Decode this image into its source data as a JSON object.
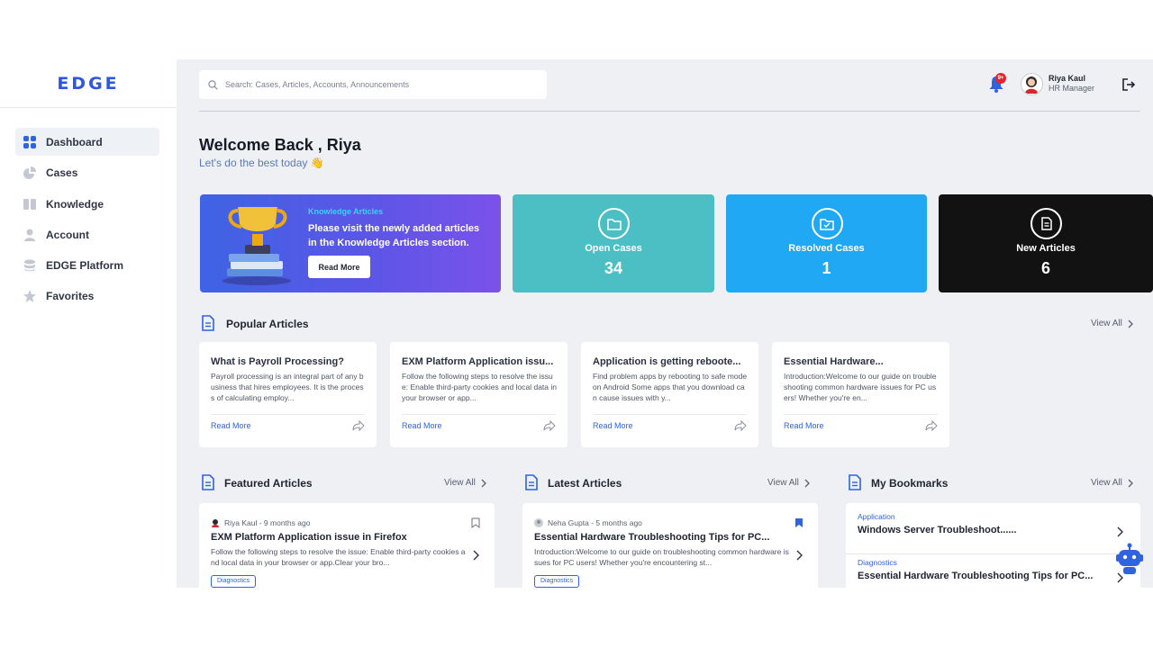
{
  "brand": {
    "logo": "EDGE",
    "accent": "#2c57e0"
  },
  "sidebar": {
    "items": [
      {
        "label": "Dashboard",
        "icon": "grid-icon",
        "active": true
      },
      {
        "label": "Cases",
        "icon": "pie-chart-icon"
      },
      {
        "label": "Knowledge",
        "icon": "book-icon"
      },
      {
        "label": "Account",
        "icon": "user-icon"
      },
      {
        "label": "EDGE Platform",
        "icon": "database-icon"
      },
      {
        "label": "Favorites",
        "icon": "star-icon"
      }
    ]
  },
  "header": {
    "search_placeholder": "Search: Cases, Articles, Accounts, Announcements",
    "notification_badge": "9+",
    "user": {
      "name": "Riya Kaul",
      "role": "HR Manager"
    }
  },
  "welcome": {
    "title": "Welcome Back , Riya",
    "subtitle": "Let's do the best today 👋"
  },
  "knowledge_banner": {
    "title": "Knowledge Articles",
    "text": "Please visit the newly added articles in the Knowledge Articles section.",
    "button": "Read More"
  },
  "stats": [
    {
      "label": "Open Cases",
      "value": "34",
      "color": "#4cbfc4",
      "icon": "folder-icon"
    },
    {
      "label": "Resolved Cases",
      "value": "1",
      "color": "#21a8f4",
      "icon": "folder-check-icon"
    },
    {
      "label": "New Articles",
      "value": "6",
      "color": "#121212",
      "icon": "document-icon"
    }
  ],
  "popular": {
    "title": "Popular Articles",
    "view_all": "View All",
    "cards": [
      {
        "title": "What is Payroll Processing?",
        "desc": "Payroll processing is an integral part of any business that hires employees. It is the process of calculating employ...",
        "read_more": "Read More"
      },
      {
        "title": "EXM Platform Application issu...",
        "desc": "Follow the following steps to resolve the issue: Enable third-party cookies and local data in your browser or app...",
        "read_more": "Read More"
      },
      {
        "title": "Application is getting reboote...",
        "desc": "Find problem apps by rebooting to safe mode on Android Some apps that you download can cause issues with y...",
        "read_more": "Read More"
      },
      {
        "title": "Essential Hardware...",
        "desc": "Introduction:Welcome to our guide on troubleshooting common hardware issues for PC users! Whether you're en...",
        "read_more": "Read More"
      }
    ]
  },
  "featured": {
    "title": "Featured Articles",
    "view_all": "View All",
    "item": {
      "meta": "Riya Kaul - 9 months ago",
      "title": "EXM Platform Application issue in Firefox",
      "desc": "Follow the following steps to resolve the issue: Enable third-party cookies and local data in your browser or app.Clear your bro...",
      "tag": "Diagnostics"
    }
  },
  "latest": {
    "title": "Latest Articles",
    "view_all": "View All",
    "item": {
      "meta": "Neha Gupta - 5 months ago",
      "title": "Essential Hardware Troubleshooting Tips for PC...",
      "desc": "Introduction:Welcome to our guide on troubleshooting common hardware issues for PC users! Whether you're encountering st...",
      "tag": "Diagnostics"
    }
  },
  "bookmarks": {
    "title": "My Bookmarks",
    "view_all": "View All",
    "items": [
      {
        "category": "Application",
        "title": "Windows Server Troubleshoot......"
      },
      {
        "category": "Diagnostics",
        "title": "Essential Hardware Troubleshooting Tips for PC..."
      }
    ]
  }
}
